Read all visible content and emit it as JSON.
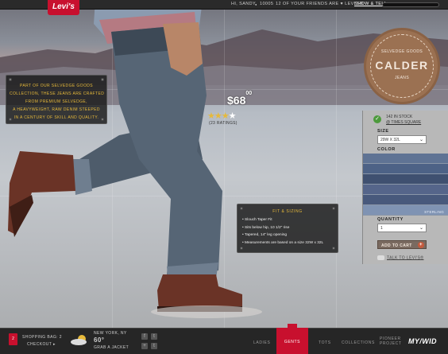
{
  "topbar": {
    "logo": "Levi's",
    "greeting": "HI, SANDY",
    "count": "10005",
    "friends_text": "12 OF YOUR FRIENDS ARE ♥ LEVI'S®",
    "show_tell": "SHOW & TELL"
  },
  "seal": {
    "line1": "SELVEDGE GOODS",
    "line2": "CALDER",
    "line3": "JEANS"
  },
  "story": {
    "lines": [
      "PART OF OUR SELVEDGE GOODS",
      "COLLECTION, THESE JEANS ARE CRAFTED",
      "FROM PREMIUM SELVEDGE,",
      "A HEAVYWEIGHT, RAW DENIM STEEPED",
      "IN A CENTURY OF SKILL AND QUALITY."
    ]
  },
  "product": {
    "price_dollars": "$68",
    "price_cents": "00",
    "rating": 3,
    "rating_max": 4,
    "ratings_count": "(23 RATINGS)"
  },
  "fit": {
    "title": "FIT & SIZING",
    "items": [
      "• Slouch Taper Fit",
      "• Sits below hip, 10 1/2\" rise",
      "• Tapered, 14\" leg opening",
      "• Measurements are based on a size 32W x 32L"
    ]
  },
  "side": {
    "stock_line1": "142 IN STOCK",
    "stock_line2": "@ TIMES SQUARE",
    "size_label": "SIZE",
    "size_value": "29W X 32L",
    "color_label": "COLOR",
    "swatch_label": "STERLING",
    "qty_label": "QUANTITY",
    "qty_value": "1",
    "add_to_cart": "ADD TO CART",
    "talk": "TALK TO LEVI'S®",
    "colors": {
      "swatch1": "#5f7394",
      "swatch2": "#4d6286",
      "swatch3": "#3f5070",
      "swatch4": "#55658a",
      "swatch5": "#6b7ea0",
      "swatch6": "#48597c",
      "swatch7": "#7f93b3"
    }
  },
  "bottom": {
    "shopping_bag": "SHOPPING BAG: 2",
    "checkout": "CHECKOUT ▸",
    "bag_count": "2",
    "city": "NEW YORK, NY",
    "temp": "60°",
    "weather_note": "GRAB A JACKET",
    "nav": [
      "LADIES",
      "GENTS",
      "TOTS",
      "COLLECTIONS",
      "PIONEER PROJECT"
    ],
    "pioneer_line1": "PIONEER",
    "pioneer_line2": "PROJECT",
    "brand_mark": "MY/WID"
  },
  "colors": {
    "brand_red": "#c8102e",
    "gold": "#e6b93a",
    "seal_brown": "#9b7152"
  }
}
